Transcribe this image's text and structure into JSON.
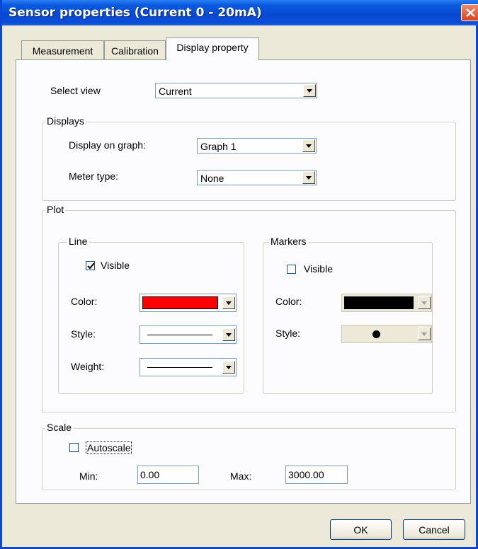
{
  "window": {
    "title": "Sensor properties (Current 0 - 20mA)"
  },
  "tabs": [
    {
      "label": "Measurement"
    },
    {
      "label": "Calibration"
    },
    {
      "label": "Display property",
      "active": true
    }
  ],
  "select_view": {
    "label": "Select view",
    "value": "Current"
  },
  "displays": {
    "title": "Displays",
    "graph_label": "Display on graph:",
    "graph_value": "Graph 1",
    "meter_label": "Meter type:",
    "meter_value": "None"
  },
  "plot": {
    "title": "Plot",
    "line": {
      "title": "Line",
      "visible_label": "Visible",
      "visible": true,
      "color_label": "Color:",
      "color": "#ff0000",
      "style_label": "Style:",
      "weight_label": "Weight:"
    },
    "markers": {
      "title": "Markers",
      "visible_label": "Visible",
      "visible": false,
      "color_label": "Color:",
      "color": "#000000",
      "style_label": "Style:"
    }
  },
  "scale": {
    "title": "Scale",
    "autoscale_label": "Autoscale",
    "autoscale": false,
    "min_label": "Min:",
    "min_value": "0.00",
    "max_label": "Max:",
    "max_value": "3000.00"
  },
  "buttons": {
    "ok": "OK",
    "cancel": "Cancel"
  },
  "colors": {
    "title_bar": "#0a48d6",
    "line_color": "#ff0000",
    "marker_color": "#000000"
  }
}
